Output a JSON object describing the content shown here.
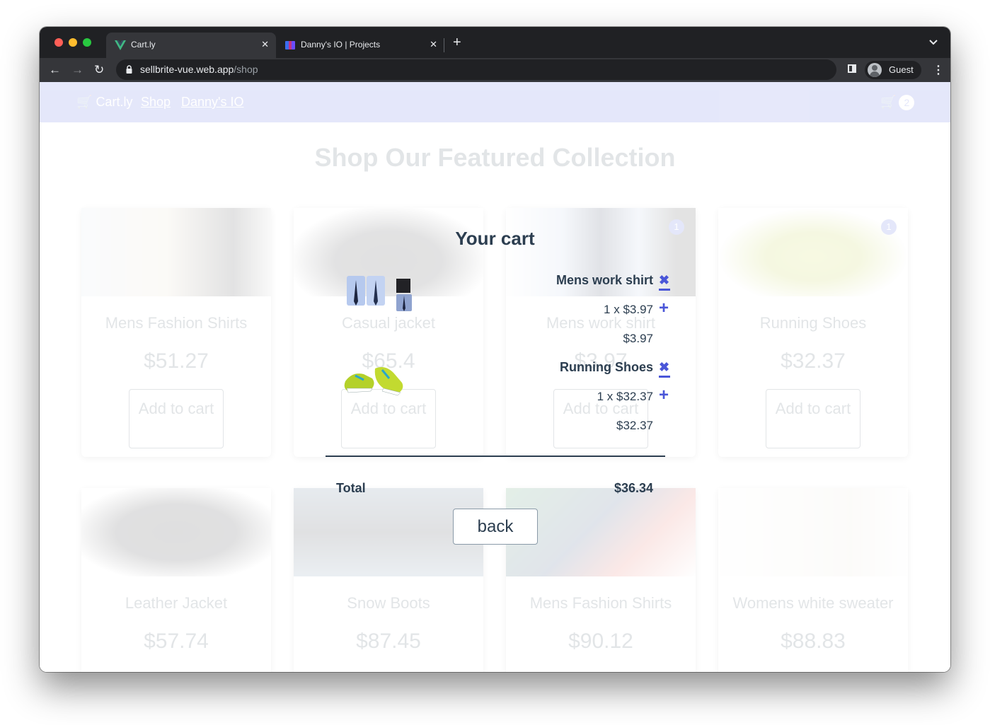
{
  "browser": {
    "tabs": [
      {
        "title": "Cart.ly",
        "favicon": "vue-logo-icon",
        "active": true
      },
      {
        "title": "Danny's IO | Projects",
        "favicon": "dannys-io-logo-icon",
        "active": false
      }
    ],
    "url_host": "sellbrite-vue.web.app",
    "url_path": "/shop",
    "profile_name": "Guest"
  },
  "navbar": {
    "brand": "Cart.ly",
    "links": [
      "Shop",
      "Danny's IO"
    ],
    "cart_count": "2",
    "color": "#3a4bdc"
  },
  "shop": {
    "title": "Shop Our Featured Collection",
    "add_label": "Add to cart",
    "products": [
      {
        "name": "Mens Fashion Shirts",
        "price": "$51.27"
      },
      {
        "name": "Casual jacket",
        "price": "$65.4"
      },
      {
        "name": "Mens work shirt",
        "price": "$3.97",
        "in_cart": "1"
      },
      {
        "name": "Running Shoes",
        "price": "$32.37",
        "in_cart": "1"
      },
      {
        "name": "Leather Jacket",
        "price": "$57.74"
      },
      {
        "name": "Snow Boots",
        "price": "$87.45"
      },
      {
        "name": "Mens Fashion Shirts",
        "price": "$90.12"
      },
      {
        "name": "Womens white sweater",
        "price": "$88.83"
      }
    ]
  },
  "cart": {
    "title": "Your cart",
    "items": [
      {
        "name": "Mens work shirt",
        "qty_line": "1 x $3.97",
        "subtotal": "$3.97"
      },
      {
        "name": "Running Shoes",
        "qty_line": "1 x $32.37",
        "subtotal": "$32.37"
      }
    ],
    "total_label": "Total",
    "total_value": "$36.34",
    "back_label": "back",
    "accent": "#4a56d8"
  }
}
